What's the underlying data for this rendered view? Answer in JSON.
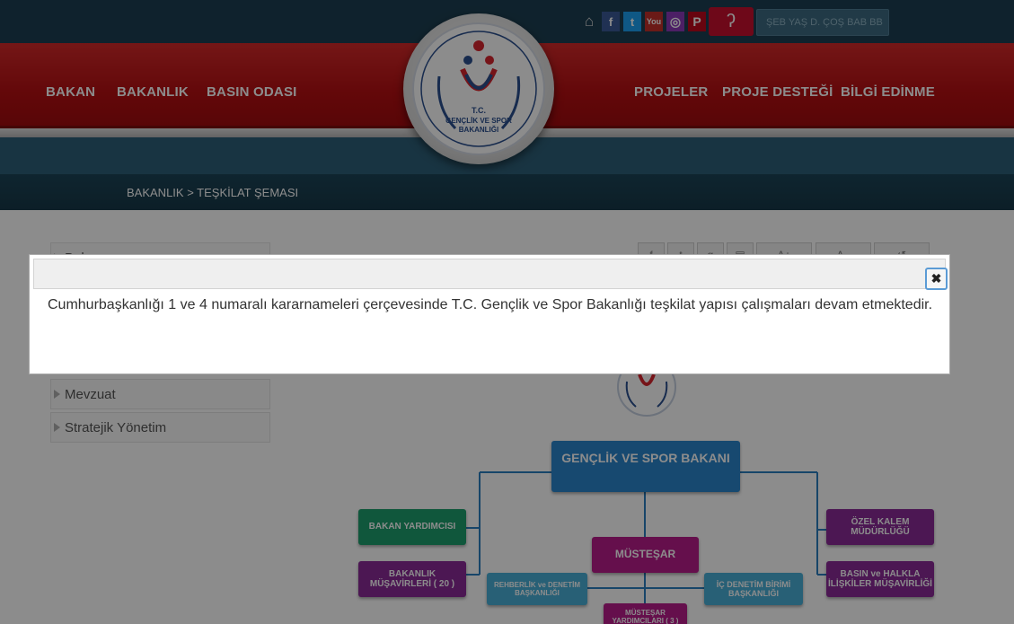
{
  "topbar": {
    "social": [
      "home-icon",
      "facebook-icon",
      "twitter-icon",
      "youtube-icon",
      "instagram-icon",
      "pinterest-icon"
    ],
    "youtube_label": "You",
    "search_placeholder": "ŞEB YAŞ D. ÇOŞ BAB BB"
  },
  "nav": {
    "left": [
      "BAKAN",
      "BAKANLIK",
      "BASIN ODASI"
    ],
    "right": [
      "PROJELER",
      "PROJE DESTEĞİ",
      "BİLGİ EDİNME"
    ]
  },
  "logo": {
    "line1": "T.C.",
    "line2": "GENÇLİK VE SPOR",
    "line3": "BAKANLIĞI"
  },
  "breadcrumb": "BAKANLIK > TEŞKİLAT ŞEMASI",
  "sidebar": {
    "items": [
      "Bakan",
      "Mevzuat",
      "Stratejik Yönetim"
    ]
  },
  "org_chart": {
    "top": "GENÇLİK VE SPOR BAKANI",
    "left_1": "BAKAN YARDIMCISI",
    "left_2": "BAKANLIK MÜŞAVİRLERİ ( 20 )",
    "center": "MÜSTEŞAR",
    "center_bottom": "MÜSTEŞAR YARDIMCILARI ( 3 )",
    "mid_left": "REHBERLİK ve DENETİM BAŞKANLIĞI",
    "mid_right": "İÇ DENETİM BİRİMİ BAŞKANLIĞI",
    "right_1": "ÖZEL KALEM MÜDÜRLÜĞÜ",
    "right_2": "BASIN ve HALKLA İLİŞKİLER MÜŞAVİRLİĞİ"
  },
  "modal": {
    "close_label": "✖",
    "message": "Cumhurbaşkanlığı 1 ve 4 numaralı kararnameleri çerçevesinde T.C. Gençlik ve Spor Bakanlığı teşkilat yapısı çalışmaları devam etmektedir."
  },
  "colors": {
    "nav_red": "#b50f12",
    "top_blue": "#1d3f52",
    "green": "#1e9e6e",
    "purple": "#a0208f",
    "teal": "#3aa0c8"
  }
}
